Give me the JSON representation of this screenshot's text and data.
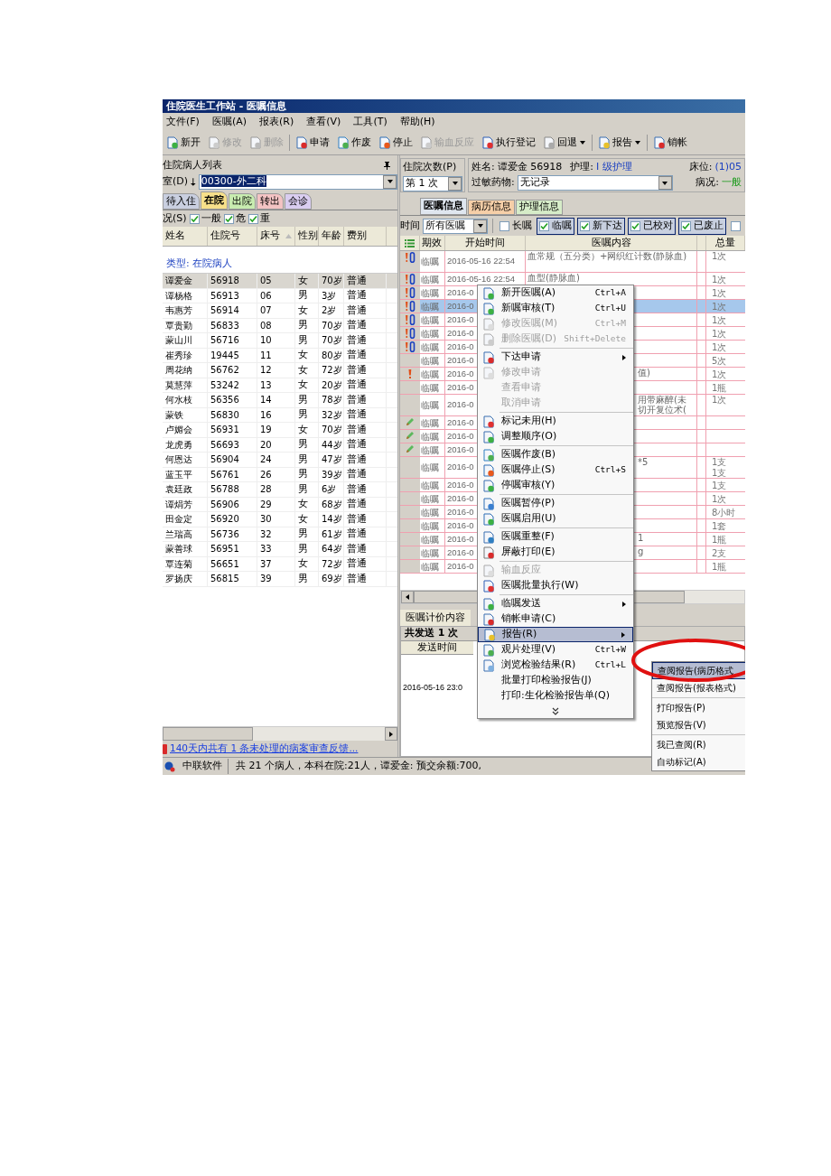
{
  "window": {
    "title": "住院医生工作站 - 医嘱信息"
  },
  "menu_bar": [
    "文件(F)",
    "医嘱(A)",
    "报表(R)",
    "查看(V)",
    "工具(T)",
    "帮助(H)"
  ],
  "toolbar": [
    {
      "label": "新开",
      "disabled": false,
      "dropdown": false
    },
    {
      "label": "修改",
      "disabled": true,
      "dropdown": false
    },
    {
      "label": "删除",
      "disabled": true,
      "dropdown": false
    },
    {
      "label": "申请",
      "disabled": false,
      "dropdown": false
    },
    {
      "label": "作废",
      "disabled": false,
      "dropdown": false
    },
    {
      "label": "停止",
      "disabled": false,
      "dropdown": false
    },
    {
      "label": "输血反应",
      "disabled": true,
      "dropdown": false
    },
    {
      "label": "执行登记",
      "disabled": false,
      "dropdown": false
    },
    {
      "label": "回退",
      "disabled": false,
      "dropdown": true
    },
    {
      "label": "报告",
      "disabled": false,
      "dropdown": true
    },
    {
      "label": "销帐",
      "disabled": false,
      "dropdown": false
    }
  ],
  "left_panel": {
    "title": "住院病人列表",
    "department": {
      "label": "室(D)",
      "value": "00300-外二科"
    },
    "tabs": [
      {
        "label": "待入住",
        "selected": false,
        "color": "#c9cfe0"
      },
      {
        "label": "在院",
        "selected": true,
        "color": "#f7e08a"
      },
      {
        "label": "出院",
        "selected": false,
        "color": "#c8ecb0"
      },
      {
        "label": "转出",
        "selected": false,
        "color": "#f3c3c3"
      },
      {
        "label": "会诊",
        "selected": false,
        "color": "#d9cdf0"
      }
    ],
    "condition": {
      "label": "况(S)",
      "options": [
        {
          "label": "一般",
          "checked": true
        },
        {
          "label": "危",
          "checked": true
        },
        {
          "label": "重",
          "checked": true
        }
      ]
    },
    "columns": [
      "姓名",
      "住院号",
      "床号",
      "性别",
      "年龄",
      "费别"
    ],
    "group": "类型: 在院病人",
    "rows": [
      {
        "name": "谭爱金",
        "id": "56918",
        "bed": "05",
        "sex": "女",
        "age": "70岁",
        "fee": "普通",
        "selected": true
      },
      {
        "name": "谭杨格",
        "id": "56913",
        "bed": "06",
        "sex": "男",
        "age": "3岁",
        "fee": "普通",
        "selected": false
      },
      {
        "name": "韦惠芳",
        "id": "56914",
        "bed": "07",
        "sex": "女",
        "age": "2岁",
        "fee": "普通",
        "selected": false
      },
      {
        "name": "覃贵勤",
        "id": "56833",
        "bed": "08",
        "sex": "男",
        "age": "70岁",
        "fee": "普通",
        "selected": false
      },
      {
        "name": "蒙山川",
        "id": "56716",
        "bed": "10",
        "sex": "男",
        "age": "70岁",
        "fee": "普通",
        "selected": false
      },
      {
        "name": "崔秀珍",
        "id": "19445",
        "bed": "11",
        "sex": "女",
        "age": "80岁",
        "fee": "普通",
        "selected": false
      },
      {
        "name": "周花纳",
        "id": "56762",
        "bed": "12",
        "sex": "女",
        "age": "72岁",
        "fee": "普通",
        "selected": false
      },
      {
        "name": "莫慧萍",
        "id": "53242",
        "bed": "13",
        "sex": "女",
        "age": "20岁",
        "fee": "普通",
        "selected": false
      },
      {
        "name": "何水枝",
        "id": "56356",
        "bed": "14",
        "sex": "男",
        "age": "78岁",
        "fee": "普通",
        "selected": false
      },
      {
        "name": "蒙铁",
        "id": "56830",
        "bed": "16",
        "sex": "男",
        "age": "32岁",
        "fee": "普通",
        "selected": false
      },
      {
        "name": "卢媚会",
        "id": "56931",
        "bed": "19",
        "sex": "女",
        "age": "70岁",
        "fee": "普通",
        "selected": false
      },
      {
        "name": "龙虎勇",
        "id": "56693",
        "bed": "20",
        "sex": "男",
        "age": "44岁",
        "fee": "普通",
        "selected": false
      },
      {
        "name": "何恩达",
        "id": "56904",
        "bed": "24",
        "sex": "男",
        "age": "47岁",
        "fee": "普通",
        "selected": false
      },
      {
        "name": "蓝玉平",
        "id": "56761",
        "bed": "26",
        "sex": "男",
        "age": "39岁",
        "fee": "普通",
        "selected": false
      },
      {
        "name": "袁廷政",
        "id": "56788",
        "bed": "28",
        "sex": "男",
        "age": "6岁",
        "fee": "普通",
        "selected": false
      },
      {
        "name": "谭焆芳",
        "id": "56906",
        "bed": "29",
        "sex": "女",
        "age": "68岁",
        "fee": "普通",
        "selected": false
      },
      {
        "name": "田金定",
        "id": "56920",
        "bed": "30",
        "sex": "女",
        "age": "14岁",
        "fee": "普通",
        "selected": false
      },
      {
        "name": "兰瑞高",
        "id": "56736",
        "bed": "32",
        "sex": "男",
        "age": "61岁",
        "fee": "普通",
        "selected": false
      },
      {
        "name": "蒙善球",
        "id": "56951",
        "bed": "33",
        "sex": "男",
        "age": "64岁",
        "fee": "普通",
        "selected": false
      },
      {
        "name": "覃连菊",
        "id": "56651",
        "bed": "37",
        "sex": "女",
        "age": "72岁",
        "fee": "普通",
        "selected": false
      },
      {
        "name": "罗扬庆",
        "id": "56815",
        "bed": "39",
        "sex": "男",
        "age": "69岁",
        "fee": "普通",
        "selected": false
      }
    ],
    "notice": "140天内共有 1 条未处理的病案审查反馈..."
  },
  "patient": {
    "admission_label": "住院次数(P)",
    "admission": "第 1 次",
    "name_label": "姓名:",
    "name": "谭爱金 56918",
    "care_label": "护理:",
    "care": "I 级护理",
    "bed_label": "床位:",
    "bed": "(1)05",
    "allergy_label": "过敏药物:",
    "allergy": "无记录",
    "condition_label": "病况:",
    "condition": "一般"
  },
  "order_tabs": [
    {
      "label": "医嘱信息",
      "selected": true,
      "color": "#dfe6ef"
    },
    {
      "label": "病历信息",
      "selected": false,
      "color": "#f6cfa8"
    },
    {
      "label": "护理信息",
      "selected": false,
      "color": "#d6ecc8"
    }
  ],
  "filter": {
    "time_label": "时间",
    "time": "所有医嘱",
    "checks": [
      {
        "label": "长嘱",
        "checked": false
      },
      {
        "label": "临嘱",
        "checked": true
      },
      {
        "label": "新下达",
        "checked": true
      },
      {
        "label": "已校对",
        "checked": true
      },
      {
        "label": "已废止",
        "checked": true
      },
      {
        "checked": false
      }
    ]
  },
  "orders": {
    "columns": [
      "期效",
      "开始时间",
      "医嘱内容",
      "总量"
    ],
    "rows": [
      {
        "kind": "alert",
        "period": "临嘱",
        "start": "2016-05-16 22:54",
        "content": "血常规（五分类）+网织红计数(静脉血)",
        "totals": [
          "1次"
        ],
        "tall": true,
        "selected": false
      },
      {
        "kind": "alert",
        "period": "临嘱",
        "start": "2016-05-16 22:54",
        "content": "血型(静脉血)",
        "totals": [
          "1次"
        ],
        "tall": false,
        "selected": false
      },
      {
        "kind": "alert",
        "period": "临嘱",
        "start": "2016-0",
        "totals": [
          "1次"
        ],
        "tall": false,
        "selected": false
      },
      {
        "kind": "alert",
        "period": "临嘱",
        "start": "2016-0",
        "totals": [
          "1次"
        ],
        "tall": false,
        "selected": true
      },
      {
        "kind": "alert",
        "period": "临嘱",
        "start": "2016-0",
        "totals": [
          "1次"
        ],
        "tall": false,
        "selected": false
      },
      {
        "kind": "alert",
        "period": "临嘱",
        "start": "2016-0",
        "totals": [
          "1次"
        ],
        "tall": false,
        "selected": false
      },
      {
        "kind": "alert",
        "period": "临嘱",
        "start": "2016-0",
        "totals": [
          "1次"
        ],
        "tall": false,
        "selected": false
      },
      {
        "kind": "plain",
        "period": "临嘱",
        "start": "2016-0",
        "totals": [
          "5次"
        ],
        "tall": false,
        "selected": false
      },
      {
        "kind": "warning",
        "period": "临嘱",
        "start": "2016-0",
        "content": "值)",
        "totals": [
          "1次"
        ],
        "tall": false,
        "selected": false
      },
      {
        "kind": "plain",
        "period": "临嘱",
        "start": "2016-0",
        "totals": [
          "1瓶"
        ],
        "tall": false,
        "selected": false
      },
      {
        "kind": "plain",
        "period": "临嘱",
        "start": "2016-0",
        "content": "用带麻醉(未切开复位术(",
        "totals": [
          "1次"
        ],
        "tall": true,
        "selected": false
      },
      {
        "kind": "edited",
        "period": "临嘱",
        "start": "2016-0",
        "tall": false,
        "selected": false
      },
      {
        "kind": "edited",
        "period": "临嘱",
        "start": "2016-0",
        "tall": false,
        "selected": false
      },
      {
        "kind": "edited",
        "period": "临嘱",
        "start": "2016-0",
        "tall": false,
        "selected": false
      },
      {
        "kind": "plain",
        "period": "临嘱",
        "start": "2016-0",
        "content": "*5",
        "totals": [
          "1支",
          "1支"
        ],
        "tall": true,
        "selected": false
      },
      {
        "kind": "plain",
        "period": "临嘱",
        "start": "2016-0",
        "totals": [
          "1支"
        ],
        "tall": false,
        "selected": false
      },
      {
        "kind": "plain",
        "period": "临嘱",
        "start": "2016-0",
        "totals": [
          "1次"
        ],
        "tall": false,
        "selected": false
      },
      {
        "kind": "plain",
        "period": "临嘱",
        "start": "2016-0",
        "totals": [
          "8小时"
        ],
        "tall": false,
        "selected": false
      },
      {
        "kind": "plain",
        "period": "临嘱",
        "start": "2016-0",
        "totals": [
          "1套"
        ],
        "tall": false,
        "selected": false
      },
      {
        "kind": "plain",
        "period": "临嘱",
        "start": "2016-0",
        "content": "1",
        "totals": [
          "1瓶"
        ],
        "tall": false,
        "selected": false
      },
      {
        "kind": "plain",
        "period": "临嘱",
        "start": "2016-0",
        "content": "g",
        "totals": [
          "2支"
        ],
        "tall": false,
        "selected": false
      },
      {
        "kind": "plain",
        "period": "临嘱",
        "start": "2016-0",
        "totals": [
          "1瓶"
        ],
        "tall": false,
        "selected": false
      }
    ]
  },
  "billing": {
    "tab": "医嘱计价内容",
    "summary": "共发送 1 次",
    "column": "发送时间",
    "value": "2016-05-16 23:0"
  },
  "context_menu": [
    {
      "kind": "item",
      "label": "新开医嘱(A)",
      "shortcut": "Ctrl+A",
      "disabled": false
    },
    {
      "kind": "item",
      "label": "新嘱审核(T)",
      "shortcut": "Ctrl+U",
      "disabled": false
    },
    {
      "kind": "item",
      "label": "修改医嘱(M)",
      "shortcut": "Ctrl+M",
      "disabled": true
    },
    {
      "kind": "item",
      "label": "删除医嘱(D)",
      "shortcut": "Shift+Delete",
      "disabled": true
    },
    {
      "kind": "separator"
    },
    {
      "kind": "item",
      "label": "下达申请",
      "disabled": false,
      "submenu": true
    },
    {
      "kind": "item",
      "label": "修改申请",
      "disabled": true
    },
    {
      "kind": "item",
      "label": "查看申请",
      "disabled": true
    },
    {
      "kind": "item",
      "label": "取消申请",
      "disabled": true
    },
    {
      "kind": "separator"
    },
    {
      "kind": "item",
      "label": "标记未用(H)",
      "disabled": false
    },
    {
      "kind": "item",
      "label": "调整顺序(O)",
      "disabled": false
    },
    {
      "kind": "separator"
    },
    {
      "kind": "item",
      "label": "医嘱作废(B)",
      "disabled": false
    },
    {
      "kind": "item",
      "label": "医嘱停止(S)",
      "shortcut": "Ctrl+S",
      "disabled": false
    },
    {
      "kind": "item",
      "label": "停嘱审核(Y)",
      "disabled": false
    },
    {
      "kind": "separator"
    },
    {
      "kind": "item",
      "label": "医嘱暂停(P)",
      "disabled": false
    },
    {
      "kind": "item",
      "label": "医嘱启用(U)",
      "disabled": false
    },
    {
      "kind": "separator"
    },
    {
      "kind": "item",
      "label": "医嘱重整(F)",
      "disabled": false
    },
    {
      "kind": "item",
      "label": "屏蔽打印(E)",
      "disabled": false
    },
    {
      "kind": "separator"
    },
    {
      "kind": "item",
      "label": "输血反应",
      "disabled": true
    },
    {
      "kind": "item",
      "label": "医嘱批量执行(W)",
      "disabled": false
    },
    {
      "kind": "separator"
    },
    {
      "kind": "item",
      "label": "临嘱发送",
      "disabled": false,
      "submenu": true
    },
    {
      "kind": "item",
      "label": "销帐申请(C)",
      "disabled": false
    },
    {
      "kind": "item",
      "label": "报告(R)",
      "disabled": false,
      "submenu": true,
      "selected": true
    },
    {
      "kind": "item",
      "label": "观片处理(V)",
      "shortcut": "Ctrl+W",
      "disabled": false
    },
    {
      "kind": "item",
      "label": "浏览检验结果(R)",
      "shortcut": "Ctrl+L",
      "disabled": false
    },
    {
      "kind": "item",
      "label": "批量打印检验报告(J)",
      "disabled": false
    },
    {
      "kind": "item",
      "label": "打印:生化检验报告单(Q)",
      "disabled": false
    },
    {
      "kind": "more"
    }
  ],
  "submenu": [
    {
      "kind": "item",
      "label": "查阅报告(病历格式",
      "selected": true
    },
    {
      "kind": "item",
      "label": "查阅报告(报表格式)",
      "selected": false
    },
    {
      "kind": "separator"
    },
    {
      "kind": "item",
      "label": "打印报告(P)",
      "selected": false
    },
    {
      "kind": "item",
      "label": "预览报告(V)",
      "selected": false
    },
    {
      "kind": "separator"
    },
    {
      "kind": "item",
      "label": "我已查阅(R)",
      "selected": false
    },
    {
      "kind": "item",
      "label": "自动标记(A)",
      "selected": false
    }
  ],
  "status_bar": {
    "app": "中联软件",
    "text": "共 21 个病人，本科在院:21人，谭爱金: 预交余额:700,"
  }
}
